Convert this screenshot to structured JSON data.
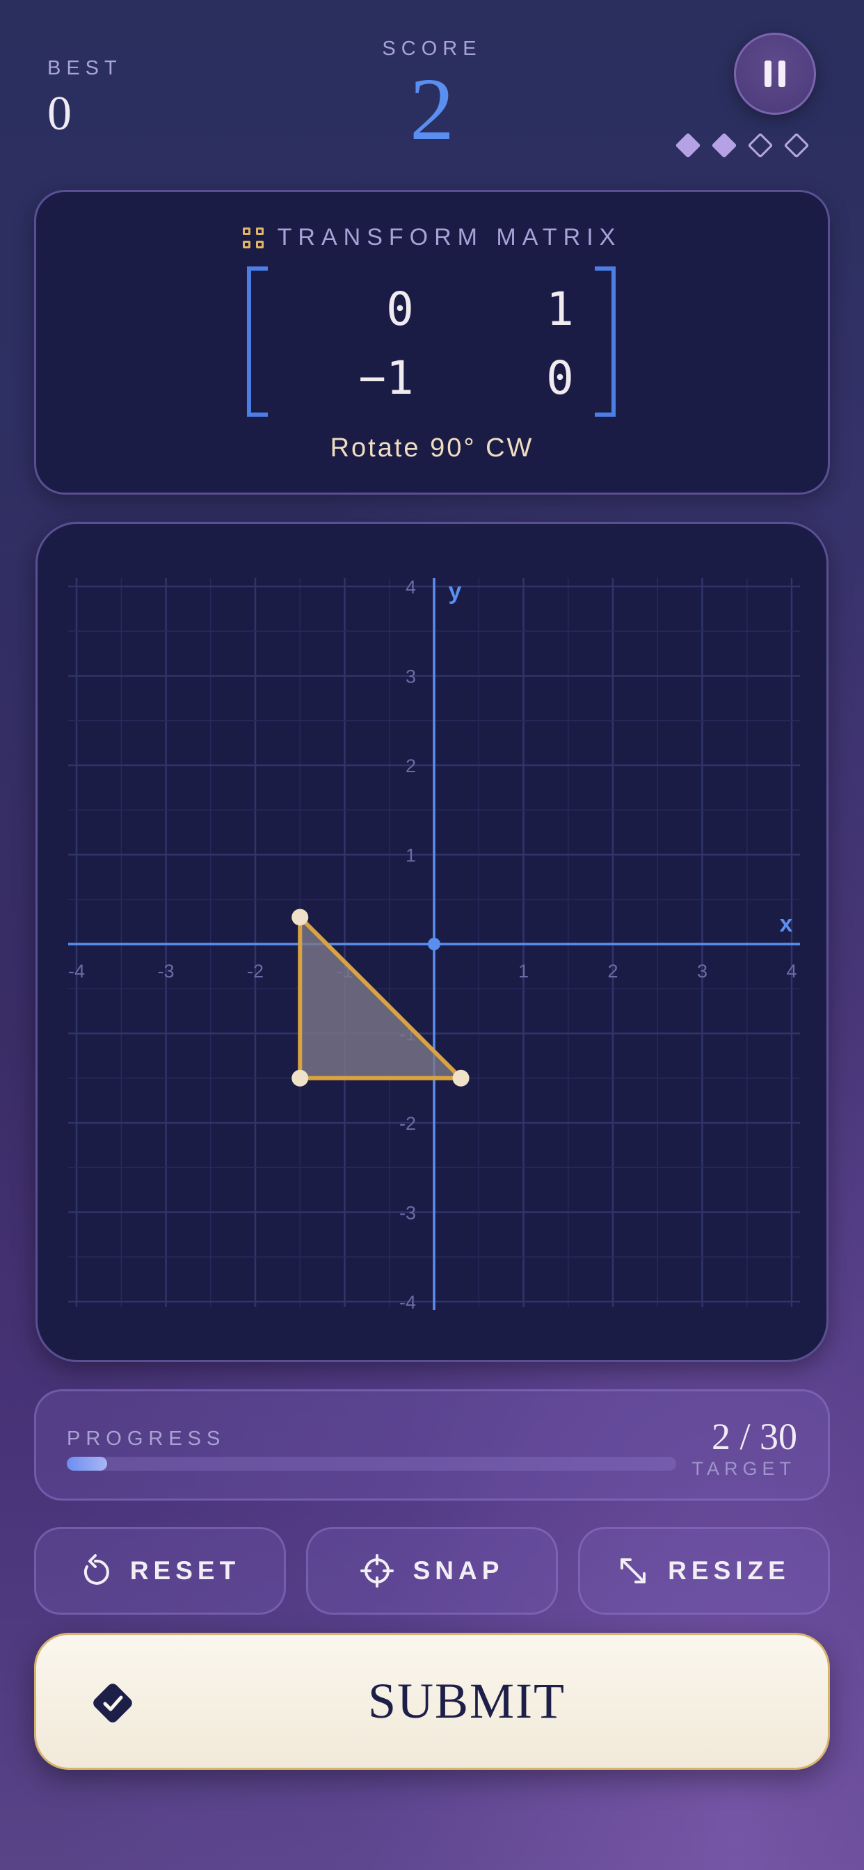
{
  "header": {
    "best_label": "BEST",
    "best_value": "0",
    "score_label": "SCORE",
    "score_value": "2",
    "pause_icon": "pause-icon",
    "lives_total": 4,
    "lives_filled": 2
  },
  "matrix": {
    "title": "TRANSFORM MATRIX",
    "icon": "grid-icon",
    "cells": [
      "0",
      "1",
      "−1",
      "0"
    ],
    "caption": "Rotate 90° CW"
  },
  "graph": {
    "x_axis_label": "x",
    "y_axis_label": "y",
    "x_ticks": [
      "-4",
      "-3",
      "-2",
      "-1",
      "1",
      "2",
      "3",
      "4"
    ],
    "y_ticks": [
      "4",
      "3",
      "2",
      "1",
      "-1",
      "-2",
      "-3",
      "-4"
    ],
    "xlim": [
      -4,
      4
    ],
    "ylim": [
      -4,
      4
    ],
    "shape_vertices": [
      [
        -1.5,
        0.3
      ],
      [
        -1.5,
        -1.5
      ],
      [
        0.3,
        -1.5
      ]
    ],
    "origin": [
      0,
      0
    ],
    "colors": {
      "axis": "#5a8ef0",
      "grid": "#2f3468",
      "shape_fill": "#7a7488",
      "shape_stroke": "#d9a440",
      "vertex": "#efe2c8"
    }
  },
  "progress": {
    "label": "PROGRESS",
    "count": "2 / 30",
    "target_label": "TARGET",
    "value": 2,
    "max": 30
  },
  "actions": [
    {
      "label": "RESET",
      "icon": "reset-icon"
    },
    {
      "label": "SNAP",
      "icon": "crosshair-icon"
    },
    {
      "label": "RESIZE",
      "icon": "resize-icon"
    }
  ],
  "submit": {
    "label": "SUBMIT",
    "icon": "check-diamond-icon"
  }
}
